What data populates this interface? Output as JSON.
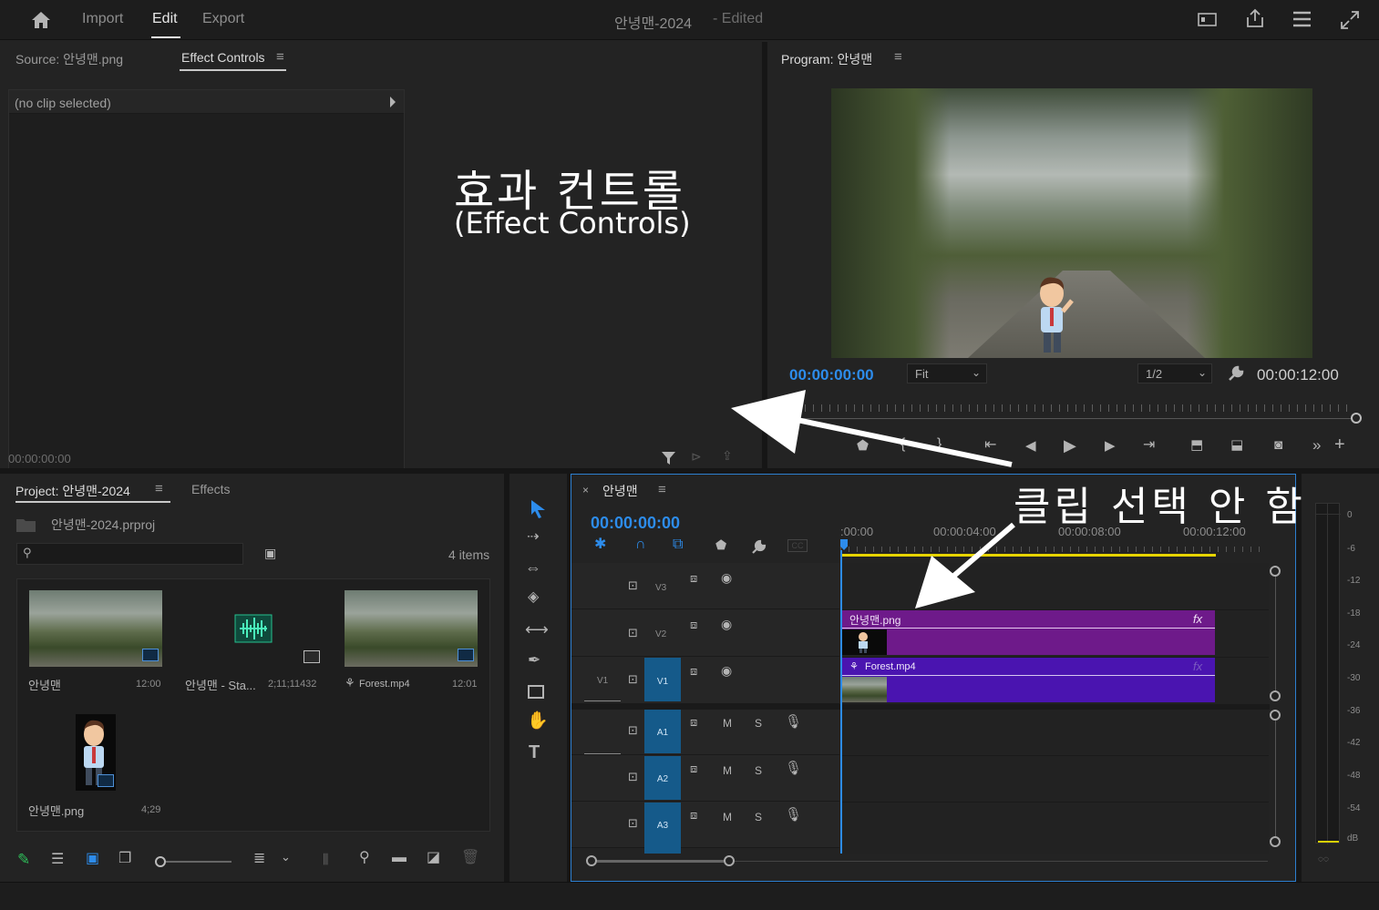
{
  "topbar": {
    "tabs": [
      "Import",
      "Edit",
      "Export"
    ],
    "title": "안녕맨-2024",
    "title_suffix": "- Edited"
  },
  "source_panel": {
    "tab_source": "Source: 안녕맨.png",
    "tab_effect_controls": "Effect Controls",
    "no_clip": "(no clip selected)",
    "timecode": "00:00:00:00"
  },
  "program_panel": {
    "tab": "Program: 안녕맨",
    "timecode": "00:00:00:00",
    "fit": "Fit",
    "resolution": "1/2",
    "duration": "00:00:12:00"
  },
  "project_panel": {
    "tab_project": "Project: 안녕맨-2024",
    "tab_effects": "Effects",
    "file": "안녕맨-2024.prproj",
    "item_count": "4 items",
    "items": [
      {
        "name": "안녕맨",
        "duration": "12:00"
      },
      {
        "name": "안녕맨 - Sta...",
        "duration": "2;11;11432"
      },
      {
        "name": "Forest.mp4",
        "duration": "12:01"
      },
      {
        "name": "안녕맨.png",
        "duration": "4;29"
      }
    ]
  },
  "timeline": {
    "tab": "안녕맨",
    "timecode": "00:00:00:00",
    "ruler": [
      ":00:00",
      "00:00:04:00",
      "00:00:08:00",
      "00:00:12:00"
    ],
    "tracks": {
      "v3": "V3",
      "v2": "V2",
      "v1": "V1",
      "v1_src": "V1",
      "a1": "A1",
      "a2": "A2",
      "a3": "A3",
      "mute": "M",
      "solo": "S"
    },
    "clips": {
      "png_clip": "안녕맨.png",
      "forest_clip": "Forest.mp4",
      "fx": "fx"
    }
  },
  "meter": {
    "labels": [
      "0",
      "-6",
      "-12",
      "-18",
      "-24",
      "-30",
      "-36",
      "-42",
      "-48",
      "-54",
      "dB"
    ]
  },
  "annotations": {
    "effect_controls_ko": "효과 컨트롤",
    "effect_controls_en": "(Effect Controls)",
    "no_clip_selected_ko": "클립 선택 안 함"
  },
  "colors": {
    "accent_blue": "#2d8ceb",
    "clip_purple": "#6e1a8a",
    "clip_indigo": "#4a14b0",
    "track_target": "#155a8a"
  }
}
